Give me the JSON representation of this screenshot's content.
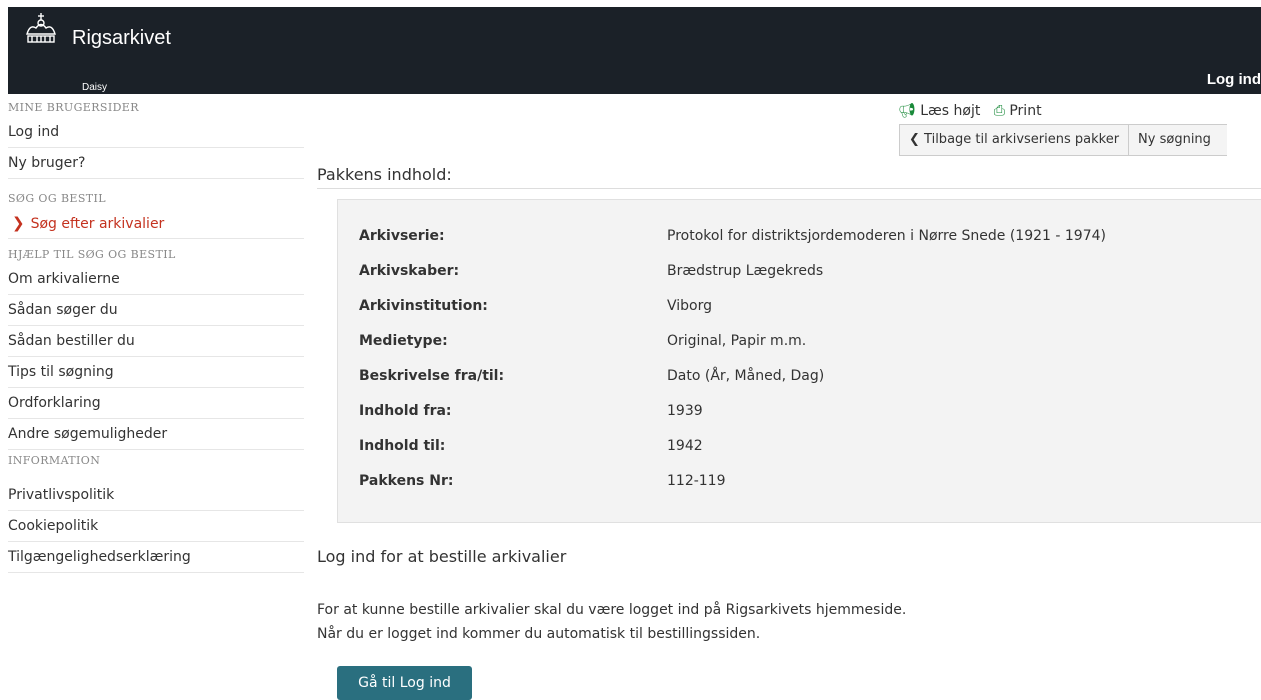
{
  "header": {
    "brand": "Rigsarkivet",
    "subtitle": "Daisy",
    "login": "Log ind"
  },
  "sidebar": {
    "sections": [
      {
        "heading": "MINE BRUGERSIDER",
        "items": [
          {
            "label": "Log ind"
          },
          {
            "label": "Ny bruger?"
          }
        ]
      },
      {
        "heading": "SØG OG BESTIL",
        "items": [
          {
            "label": "Søg efter arkivalier",
            "active": true
          }
        ]
      },
      {
        "heading": "HJÆLP TIL SØG OG BESTIL",
        "items": [
          {
            "label": "Om arkivalierne"
          },
          {
            "label": "Sådan søger du"
          },
          {
            "label": "Sådan bestiller du"
          },
          {
            "label": "Tips til søgning"
          },
          {
            "label": "Ordforklaring"
          },
          {
            "label": "Andre søgemuligheder"
          }
        ]
      },
      {
        "heading": "INFORMATION",
        "items": [
          {
            "label": "Privatlivspolitik"
          },
          {
            "label": "Cookiepolitik"
          },
          {
            "label": "Tilgængelighedserklæring"
          }
        ]
      }
    ]
  },
  "tools": {
    "read_aloud": "Læs højt",
    "print": "Print"
  },
  "buttons": {
    "back": "Tilbage til arkivseriens pakker",
    "new_search": "Ny søgning"
  },
  "main": {
    "title": "Pakkens indhold:",
    "details": [
      {
        "label": "Arkivserie:",
        "value": "Protokol for distriktsjordemoderen i Nørre Snede (1921 - 1974)"
      },
      {
        "label": "Arkivskaber:",
        "value": "Brædstrup Lægekreds"
      },
      {
        "label": "Arkivinstitution:",
        "value": "Viborg"
      },
      {
        "label": "Medietype:",
        "value": "Original, Papir m.m."
      },
      {
        "label": "Beskrivelse fra/til:",
        "value": "Dato (År, Måned, Dag)"
      },
      {
        "label": "Indhold fra:",
        "value": "1939"
      },
      {
        "label": "Indhold til:",
        "value": "1942"
      },
      {
        "label": "Pakkens Nr:",
        "value": "112-119"
      }
    ],
    "login_heading": "Log ind for at bestille arkivalier",
    "login_text_1": "For at kunne bestille arkivalier skal du være logget ind på Rigsarkivets hjemmeside.",
    "login_text_2": "Når du er logget ind kommer du automatisk til bestillingssiden.",
    "login_button": "Gå til Log ind"
  },
  "colors": {
    "topbar": "#1b2128",
    "active_link": "#c4321f",
    "tool_icon": "#1a8a3a",
    "primary_button": "#2a6f7f"
  }
}
